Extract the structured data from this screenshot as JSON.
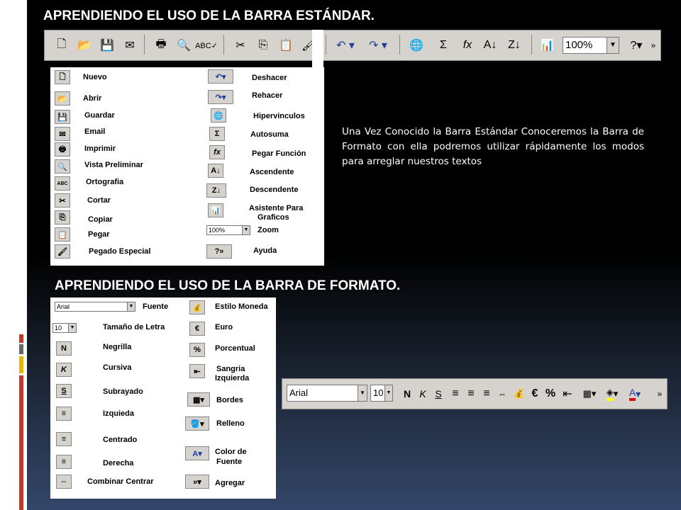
{
  "title_std": "APRENDIENDO EL USO DE LA BARRA ESTÁNDAR.",
  "title_fmt": "APRENDIENDO EL USO DE LA BARRA DE FORMATO.",
  "description": "Una Vez Conocido la Barra Estándar Conoceremos la Barra de Formato con ella podremos utilizar rápidamente los modos para arreglar nuestros textos",
  "std_toolbar": {
    "zoom_value": "100%"
  },
  "std_left": [
    "Nuevo",
    "Abrir",
    "Guardar",
    "Email",
    "Imprimir",
    "Vista Preliminar",
    "Ortografia",
    "Cortar",
    "Copiar",
    "Pegar",
    "Pegado Especial"
  ],
  "std_right": [
    "Deshacer",
    "Rehacer",
    "Hipervinculos",
    "Autosuma",
    "Pegar Función",
    "Ascendente",
    "Descendente",
    "Asistente Para",
    "Graficos",
    "Zoom",
    "Ayuda"
  ],
  "std_zoom_combo": "100%",
  "fmt_left": [
    "Fuente",
    "Tamaño de Letra",
    "Negrilla",
    "Cursiva",
    "Subrayado",
    "Izquieda",
    "Centrado",
    "Derecha",
    "Combinar Centrar"
  ],
  "fmt_right": [
    "Estilo Moneda",
    "Euro",
    "Porcentual",
    "Sangria",
    "Izquierda",
    "Bordes",
    "Relleno",
    "Color de",
    "Fuente",
    "Agregar"
  ],
  "fmt_font_combo": "Arial",
  "fmt_size_combo": "10",
  "fmt_toolbar": {
    "font": "Arial",
    "size": "10"
  },
  "colors": {
    "accent_red": "#c0392b",
    "accent_yellow": "#e6b800",
    "accent_gray": "#666666",
    "toolbar_bg": "#d6d3ce"
  }
}
